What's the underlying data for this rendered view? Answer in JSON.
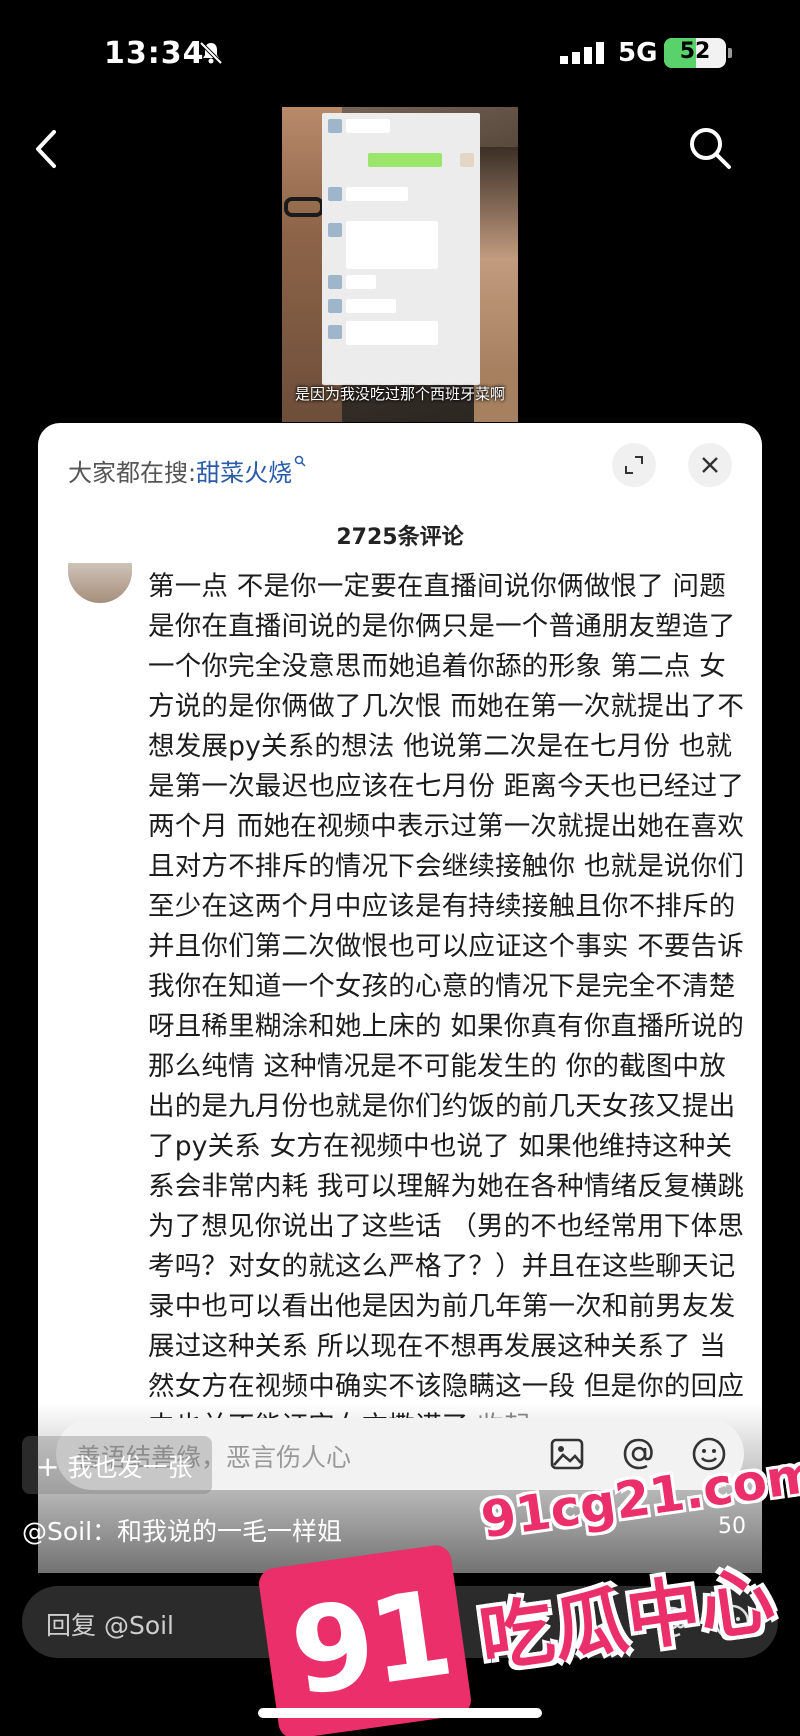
{
  "status_bar": {
    "time": "13:34",
    "network": "5G",
    "battery": "52",
    "battery_level": 0.52
  },
  "video": {
    "subtitle": "是因为我没吃过那个西班牙菜啊"
  },
  "comment_panel": {
    "search_hint_prefix": "大家都在搜:",
    "search_keyword": "甜菜火烧",
    "comment_count": "2725条评论",
    "comment_text": "第一点 不是你一定要在直播间说你俩做恨了 问题是你在直播间说的是你俩只是一个普通朋友塑造了一个你完全没意思而她追着你舔的形象 第二点 女方说的是你俩做了几次恨 而她在第一次就提出了不想发展py关系的想法 他说第二次是在七月份 也就是第一次最迟也应该在七月份 距离今天也已经过了两个月 而她在视频中表示过第一次就提出她在喜欢且对方不排斥的情况下会继续接触你 也就是说你们至少在这两个月中应该是有持续接触且你不排斥的 并且你们第二次做恨也可以应证这个事实 不要告诉我你在知道一个女孩的心意的情况下是完全不清楚呀且稀里糊涂和她上床的 如果你真有你直播所说的那么纯情 这种情况是不可能发生的 你的截图中放出的是九月份也就是你们约饭的前几天女孩又提出了py关系 女方在视频中也说了 如果他维持这种关系会非常内耗 我可以理解为她在各种情绪反复横跳为了想见你说出了这些话 （男的不也经常用下体思考吗？对女的就这么严格了？）并且在这些聊天记录中也可以看出他是因为前几年第一次和前男友发展过这种关系 所以现在不想再发展这种关系了 当然女方在视频中确实不该隐瞒这一段 但是你的回应中也并不能证实女方撒谎了",
    "collapse_label": "收起",
    "input_placeholder": "善语结善缘，恶言伤人心"
  },
  "post_button_label": "我也发一张",
  "reply_preview": {
    "text": "@Soil：和我说的一毛一样姐",
    "count": "50"
  },
  "reply_input_placeholder": "回复 @Soil",
  "watermark": {
    "number": "91",
    "site": "91cg21.com",
    "name": "吃瓜中心"
  },
  "icons": [
    "back-icon",
    "search-icon",
    "expand-icon",
    "close-icon",
    "image-icon",
    "at-icon",
    "emoji-icon"
  ],
  "colors": {
    "keyword": "#2a5ba8",
    "watermark": "#ea2f6a",
    "battery": "#5ad26b"
  }
}
